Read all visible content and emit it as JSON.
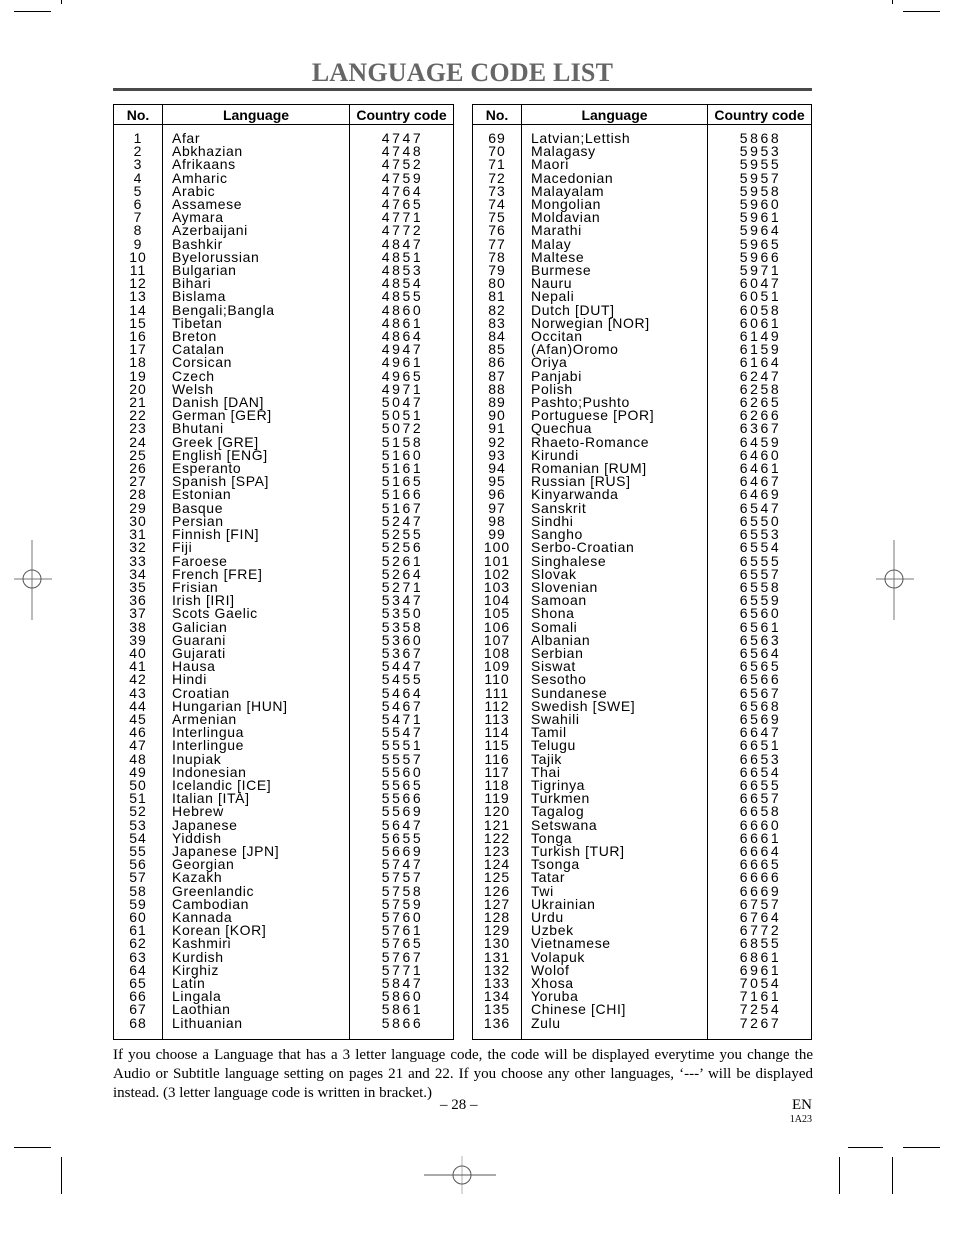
{
  "page": {
    "title": "LANGUAGE CODE LIST",
    "columns": [
      "No.",
      "Language",
      "Country code"
    ],
    "note": "If you choose a Language that has a 3 letter language code, the code will be displayed everytime you change the Audio or Subtitle language setting on pages 21 and 22. If you choose any other languages, ‘---’ will be displayed instead. (3 letter language code is written in bracket.)",
    "page_number": "– 28 –",
    "language_code": "EN",
    "model_code": "1A23"
  },
  "left_table": [
    {
      "no": "1",
      "language": "Afar",
      "code": "4747"
    },
    {
      "no": "2",
      "language": "Abkhazian",
      "code": "4748"
    },
    {
      "no": "3",
      "language": "Afrikaans",
      "code": "4752"
    },
    {
      "no": "4",
      "language": "Amharic",
      "code": "4759"
    },
    {
      "no": "5",
      "language": "Arabic",
      "code": "4764"
    },
    {
      "no": "6",
      "language": "Assamese",
      "code": "4765"
    },
    {
      "no": "7",
      "language": "Aymara",
      "code": "4771"
    },
    {
      "no": "8",
      "language": "Azerbaijani",
      "code": "4772"
    },
    {
      "no": "9",
      "language": "Bashkir",
      "code": "4847"
    },
    {
      "no": "10",
      "language": "Byelorussian",
      "code": "4851"
    },
    {
      "no": "11",
      "language": "Bulgarian",
      "code": "4853"
    },
    {
      "no": "12",
      "language": "Bihari",
      "code": "4854"
    },
    {
      "no": "13",
      "language": "Bislama",
      "code": "4855"
    },
    {
      "no": "14",
      "language": "Bengali;Bangla",
      "code": "4860"
    },
    {
      "no": "15",
      "language": "Tibetan",
      "code": "4861"
    },
    {
      "no": "16",
      "language": "Breton",
      "code": "4864"
    },
    {
      "no": "17",
      "language": "Catalan",
      "code": "4947"
    },
    {
      "no": "18",
      "language": "Corsican",
      "code": "4961"
    },
    {
      "no": "19",
      "language": "Czech",
      "code": "4965"
    },
    {
      "no": "20",
      "language": "Welsh",
      "code": "4971"
    },
    {
      "no": "21",
      "language": "Danish [DAN]",
      "code": "5047"
    },
    {
      "no": "22",
      "language": "German [GER]",
      "code": "5051"
    },
    {
      "no": "23",
      "language": "Bhutani",
      "code": "5072"
    },
    {
      "no": "24",
      "language": "Greek [GRE]",
      "code": "5158"
    },
    {
      "no": "25",
      "language": "English [ENG]",
      "code": "5160"
    },
    {
      "no": "26",
      "language": "Esperanto",
      "code": "5161"
    },
    {
      "no": "27",
      "language": "Spanish [SPA]",
      "code": "5165"
    },
    {
      "no": "28",
      "language": "Estonian",
      "code": "5166"
    },
    {
      "no": "29",
      "language": "Basque",
      "code": "5167"
    },
    {
      "no": "30",
      "language": "Persian",
      "code": "5247"
    },
    {
      "no": "31",
      "language": "Finnish [FIN]",
      "code": "5255"
    },
    {
      "no": "32",
      "language": "Fiji",
      "code": "5256"
    },
    {
      "no": "33",
      "language": "Faroese",
      "code": "5261"
    },
    {
      "no": "34",
      "language": "French [FRE]",
      "code": "5264"
    },
    {
      "no": "35",
      "language": "Frisian",
      "code": "5271"
    },
    {
      "no": "36",
      "language": "Irish [IRI]",
      "code": "5347"
    },
    {
      "no": "37",
      "language": "Scots Gaelic",
      "code": "5350"
    },
    {
      "no": "38",
      "language": "Galician",
      "code": "5358"
    },
    {
      "no": "39",
      "language": "Guarani",
      "code": "5360"
    },
    {
      "no": "40",
      "language": "Gujarati",
      "code": "5367"
    },
    {
      "no": "41",
      "language": "Hausa",
      "code": "5447"
    },
    {
      "no": "42",
      "language": "Hindi",
      "code": "5455"
    },
    {
      "no": "43",
      "language": "Croatian",
      "code": "5464"
    },
    {
      "no": "44",
      "language": "Hungarian [HUN]",
      "code": "5467"
    },
    {
      "no": "45",
      "language": "Armenian",
      "code": "5471"
    },
    {
      "no": "46",
      "language": "Interlingua",
      "code": "5547"
    },
    {
      "no": "47",
      "language": "Interlingue",
      "code": "5551"
    },
    {
      "no": "48",
      "language": "Inupiak",
      "code": "5557"
    },
    {
      "no": "49",
      "language": "Indonesian",
      "code": "5560"
    },
    {
      "no": "50",
      "language": "Icelandic [ICE]",
      "code": "5565"
    },
    {
      "no": "51",
      "language": "Italian [ITA]",
      "code": "5566"
    },
    {
      "no": "52",
      "language": "Hebrew",
      "code": "5569"
    },
    {
      "no": "53",
      "language": "Japanese",
      "code": "5647"
    },
    {
      "no": "54",
      "language": "Yiddish",
      "code": "5655"
    },
    {
      "no": "55",
      "language": "Japanese [JPN]",
      "code": "5669"
    },
    {
      "no": "56",
      "language": "Georgian",
      "code": "5747"
    },
    {
      "no": "57",
      "language": "Kazakh",
      "code": "5757"
    },
    {
      "no": "58",
      "language": "Greenlandic",
      "code": "5758"
    },
    {
      "no": "59",
      "language": "Cambodian",
      "code": "5759"
    },
    {
      "no": "60",
      "language": "Kannada",
      "code": "5760"
    },
    {
      "no": "61",
      "language": "Korean [KOR]",
      "code": "5761"
    },
    {
      "no": "62",
      "language": "Kashmiri",
      "code": "5765"
    },
    {
      "no": "63",
      "language": "Kurdish",
      "code": "5767"
    },
    {
      "no": "64",
      "language": "Kirghiz",
      "code": "5771"
    },
    {
      "no": "65",
      "language": "Latin",
      "code": "5847"
    },
    {
      "no": "66",
      "language": "Lingala",
      "code": "5860"
    },
    {
      "no": "67",
      "language": "Laothian",
      "code": "5861"
    },
    {
      "no": "68",
      "language": "Lithuanian",
      "code": "5866"
    }
  ],
  "right_table": [
    {
      "no": "69",
      "language": "Latvian;Lettish",
      "code": "5868"
    },
    {
      "no": "70",
      "language": "Malagasy",
      "code": "5953"
    },
    {
      "no": "71",
      "language": "Maori",
      "code": "5955"
    },
    {
      "no": "72",
      "language": "Macedonian",
      "code": "5957"
    },
    {
      "no": "73",
      "language": "Malayalam",
      "code": "5958"
    },
    {
      "no": "74",
      "language": "Mongolian",
      "code": "5960"
    },
    {
      "no": "75",
      "language": "Moldavian",
      "code": "5961"
    },
    {
      "no": "76",
      "language": "Marathi",
      "code": "5964"
    },
    {
      "no": "77",
      "language": "Malay",
      "code": "5965"
    },
    {
      "no": "78",
      "language": "Maltese",
      "code": "5966"
    },
    {
      "no": "79",
      "language": "Burmese",
      "code": "5971"
    },
    {
      "no": "80",
      "language": "Nauru",
      "code": "6047"
    },
    {
      "no": "81",
      "language": "Nepali",
      "code": "6051"
    },
    {
      "no": "82",
      "language": "Dutch [DUT]",
      "code": "6058"
    },
    {
      "no": "83",
      "language": "Norwegian [NOR]",
      "code": "6061"
    },
    {
      "no": "84",
      "language": "Occitan",
      "code": "6149"
    },
    {
      "no": "85",
      "language": "(Afan)Oromo",
      "code": "6159"
    },
    {
      "no": "86",
      "language": "Oriya",
      "code": "6164"
    },
    {
      "no": "87",
      "language": "Panjabi",
      "code": "6247"
    },
    {
      "no": "88",
      "language": "Polish",
      "code": "6258"
    },
    {
      "no": "89",
      "language": "Pashto;Pushto",
      "code": "6265"
    },
    {
      "no": "90",
      "language": "Portuguese [POR]",
      "code": "6266"
    },
    {
      "no": "91",
      "language": "Quechua",
      "code": "6367"
    },
    {
      "no": "92",
      "language": "Rhaeto-Romance",
      "code": "6459"
    },
    {
      "no": "93",
      "language": "Kirundi",
      "code": "6460"
    },
    {
      "no": "94",
      "language": "Romanian [RUM]",
      "code": "6461"
    },
    {
      "no": "95",
      "language": "Russian [RUS]",
      "code": "6467"
    },
    {
      "no": "96",
      "language": "Kinyarwanda",
      "code": "6469"
    },
    {
      "no": "97",
      "language": "Sanskrit",
      "code": "6547"
    },
    {
      "no": "98",
      "language": "Sindhi",
      "code": "6550"
    },
    {
      "no": "99",
      "language": "Sangho",
      "code": "6553"
    },
    {
      "no": "100",
      "language": "Serbo-Croatian",
      "code": "6554"
    },
    {
      "no": "101",
      "language": "Singhalese",
      "code": "6555"
    },
    {
      "no": "102",
      "language": "Slovak",
      "code": "6557"
    },
    {
      "no": "103",
      "language": "Slovenian",
      "code": "6558"
    },
    {
      "no": "104",
      "language": "Samoan",
      "code": "6559"
    },
    {
      "no": "105",
      "language": "Shona",
      "code": "6560"
    },
    {
      "no": "106",
      "language": "Somali",
      "code": "6561"
    },
    {
      "no": "107",
      "language": "Albanian",
      "code": "6563"
    },
    {
      "no": "108",
      "language": "Serbian",
      "code": "6564"
    },
    {
      "no": "109",
      "language": "Siswat",
      "code": "6565"
    },
    {
      "no": "110",
      "language": "Sesotho",
      "code": "6566"
    },
    {
      "no": "111",
      "language": "Sundanese",
      "code": "6567"
    },
    {
      "no": "112",
      "language": "Swedish [SWE]",
      "code": "6568"
    },
    {
      "no": "113",
      "language": "Swahili",
      "code": "6569"
    },
    {
      "no": "114",
      "language": "Tamil",
      "code": "6647"
    },
    {
      "no": "115",
      "language": "Telugu",
      "code": "6651"
    },
    {
      "no": "116",
      "language": "Tajik",
      "code": "6653"
    },
    {
      "no": "117",
      "language": "Thai",
      "code": "6654"
    },
    {
      "no": "118",
      "language": "Tigrinya",
      "code": "6655"
    },
    {
      "no": "119",
      "language": "Turkmen",
      "code": "6657"
    },
    {
      "no": "120",
      "language": "Tagalog",
      "code": "6658"
    },
    {
      "no": "121",
      "language": "Setswana",
      "code": "6660"
    },
    {
      "no": "122",
      "language": "Tonga",
      "code": "6661"
    },
    {
      "no": "123",
      "language": "Turkish [TUR]",
      "code": "6664"
    },
    {
      "no": "124",
      "language": "Tsonga",
      "code": "6665"
    },
    {
      "no": "125",
      "language": "Tatar",
      "code": "6666"
    },
    {
      "no": "126",
      "language": "Twi",
      "code": "6669"
    },
    {
      "no": "127",
      "language": "Ukrainian",
      "code": "6757"
    },
    {
      "no": "128",
      "language": "Urdu",
      "code": "6764"
    },
    {
      "no": "129",
      "language": "Uzbek",
      "code": "6772"
    },
    {
      "no": "130",
      "language": "Vietnamese",
      "code": "6855"
    },
    {
      "no": "131",
      "language": "Volapuk",
      "code": "6861"
    },
    {
      "no": "132",
      "language": "Wolof",
      "code": "6961"
    },
    {
      "no": "133",
      "language": "Xhosa",
      "code": "7054"
    },
    {
      "no": "134",
      "language": "Yoruba",
      "code": "7161"
    },
    {
      "no": "135",
      "language": "Chinese [CHI]",
      "code": "7254"
    },
    {
      "no": "136",
      "language": "Zulu",
      "code": "7267"
    }
  ]
}
